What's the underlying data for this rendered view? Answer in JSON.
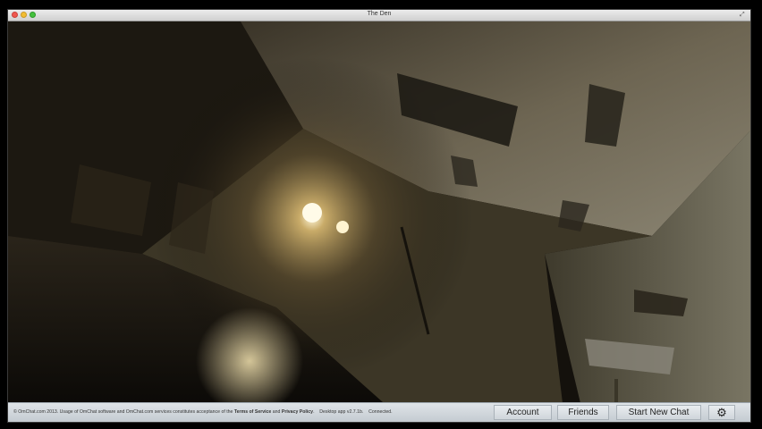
{
  "window": {
    "title": "The Den"
  },
  "footer": {
    "legal_prefix": "© OmChat.com 2013. Usage of OmChat software and OmChat.com services constitutes acceptance of the ",
    "terms_link": "Terms of Service",
    "and_text": " and ",
    "privacy_link": "Privacy Policy",
    "legal_suffix": ".",
    "version": "Desktop app v2.7.1b.",
    "status": "Connected."
  },
  "buttons": {
    "account": "Account",
    "friends": "Friends",
    "start_new_chat": "Start New Chat",
    "settings_icon": "gear-icon"
  },
  "colors": {
    "footer_bg": "#d3d9de",
    "titlebar_bg": "#dcdcdc"
  }
}
